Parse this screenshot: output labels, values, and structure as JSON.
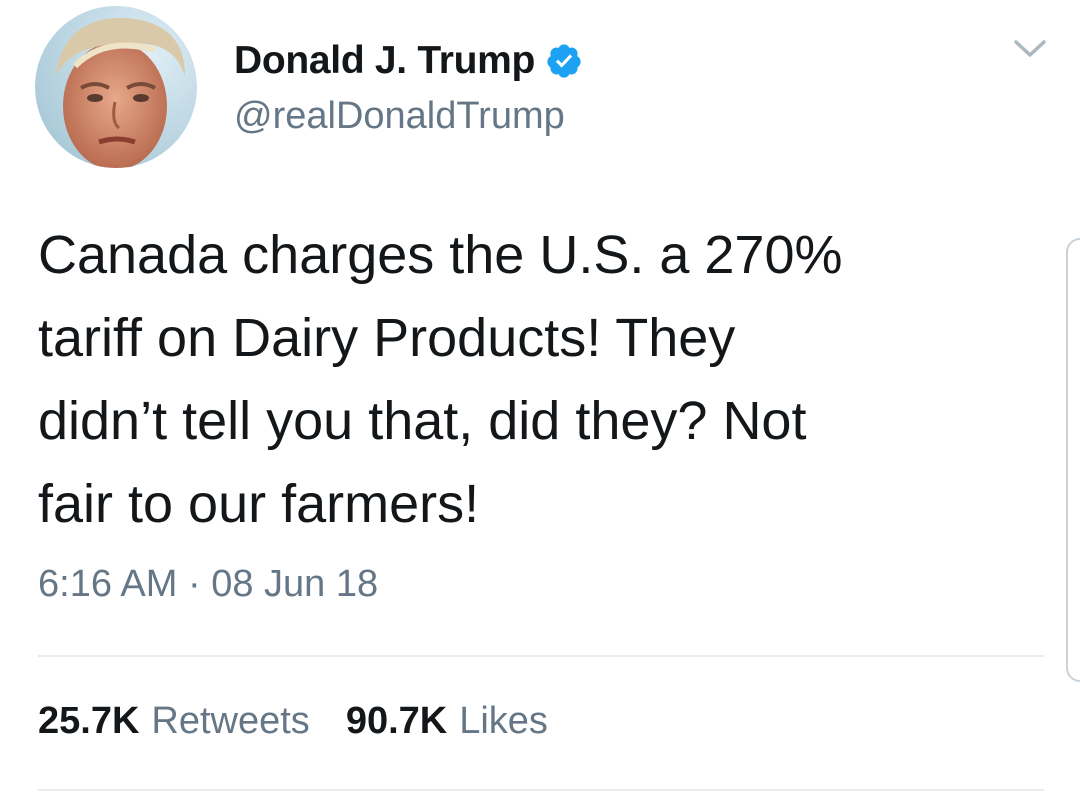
{
  "tweet": {
    "author": {
      "display_name": "Donald J. Trump",
      "handle": "@realDonaldTrump",
      "verified": true,
      "avatar": "profile-photo"
    },
    "text": "Canada charges the U.S. a 270%\ntariff on Dairy Products! They\ndidn’t tell you that, did they? Not\nfair to our farmers!",
    "timestamp": "6:16 AM · 08 Jun 18",
    "stats": {
      "retweets_count": "25.7K",
      "retweets_label": "Retweets",
      "likes_count": "90.7K",
      "likes_label": "Likes"
    }
  },
  "icons": {
    "verified": "verified-badge-icon",
    "menu": "chevron-down-icon"
  },
  "colors": {
    "verified_blue": "#1da1f2",
    "text_primary": "#14171a",
    "text_secondary": "#657786",
    "divider": "#e6ecf0"
  }
}
